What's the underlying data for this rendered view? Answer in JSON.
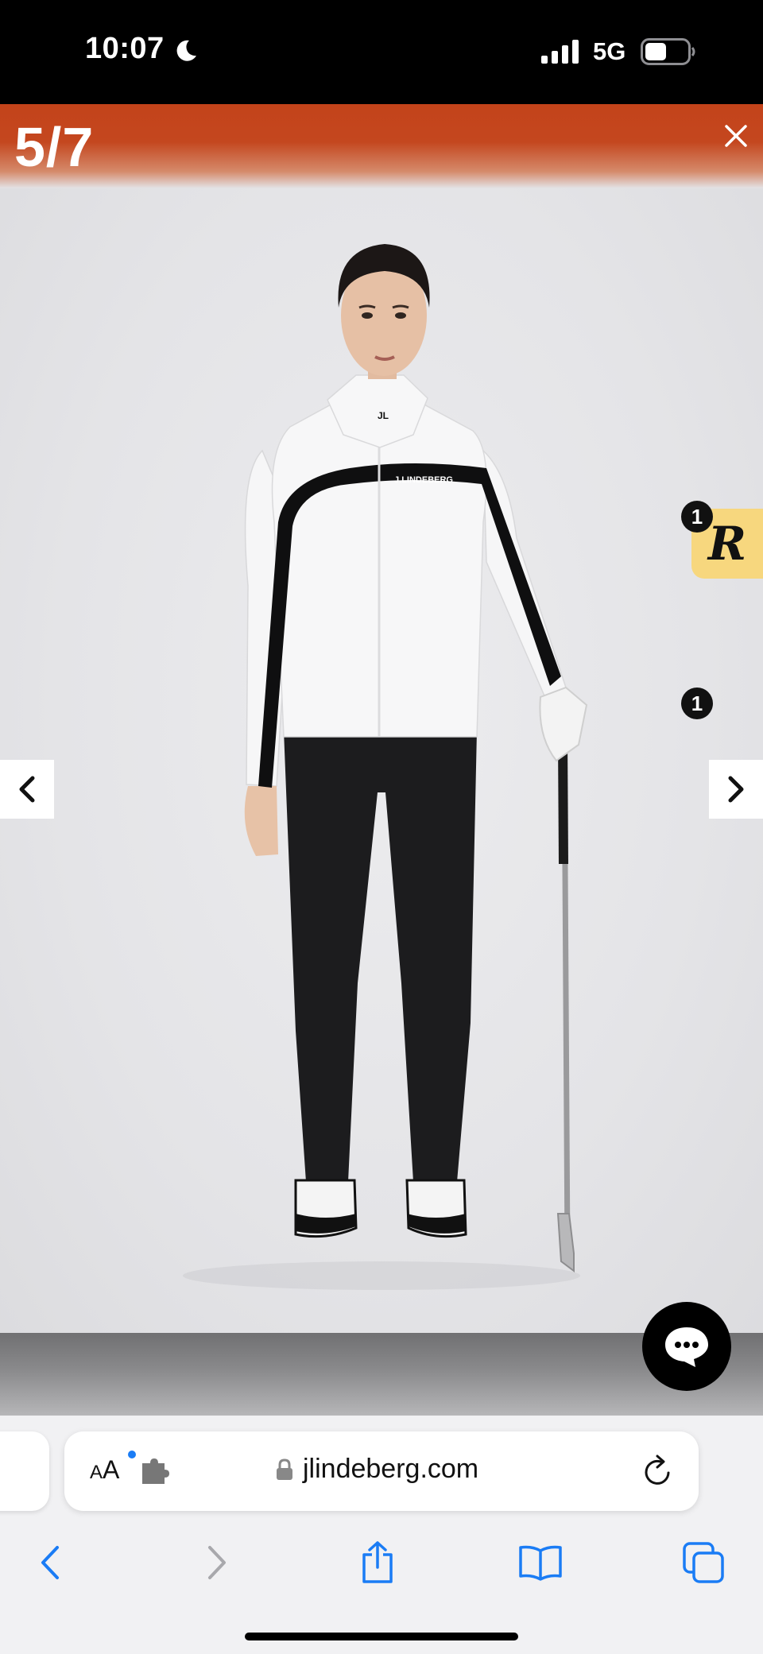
{
  "status_bar": {
    "time": "10:07",
    "network": "5G",
    "icons": [
      "moon-icon",
      "signal-icon",
      "battery-icon"
    ]
  },
  "gallery": {
    "counter": "5/7",
    "close_icon": "close-icon",
    "prev_icon": "chevron-left-icon",
    "next_icon": "chevron-right-icon",
    "brand_color": "#c3431a"
  },
  "product_image": {
    "jacket_logo": "J.LINDEBERG",
    "collar_logo": "JL"
  },
  "rewards": {
    "label": "R",
    "badge_count": "1",
    "color": "#f7d77e"
  },
  "chat": {
    "icon": "chat-bubble-icon"
  },
  "browser": {
    "text_size_label_small": "A",
    "text_size_label_large": "A",
    "domain": "jlindeberg.com",
    "icons": [
      "extension-icon",
      "lock-icon",
      "reload-icon"
    ],
    "toolbar": [
      "back-icon",
      "forward-icon",
      "share-icon",
      "bookmarks-icon",
      "tabs-icon"
    ],
    "accent": "#1a7cf5"
  }
}
